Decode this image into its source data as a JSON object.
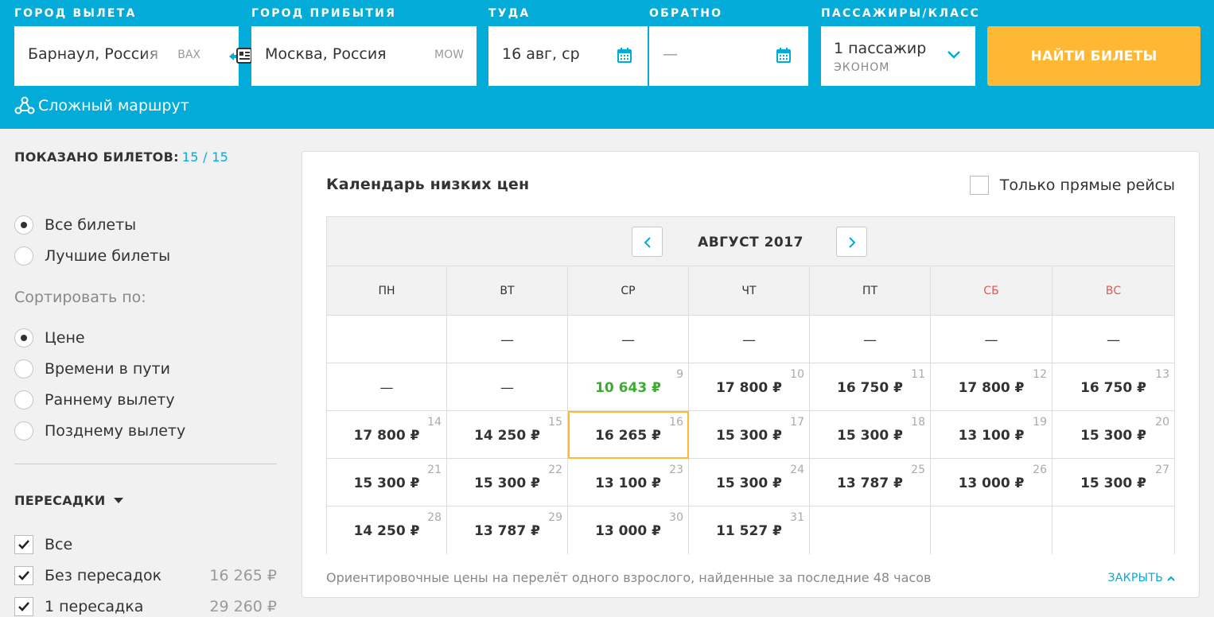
{
  "search": {
    "from_label": "ГОРОД ВЫЛЕТА",
    "from_value": "Барнаул, Россия",
    "from_code": "BAX",
    "to_label": "ГОРОД ПРИБЫТИЯ",
    "to_value": "Москва, Россия",
    "to_code": "MOW",
    "depart_label": "ТУДА",
    "depart_value": "16 авг, ср",
    "return_label": "ОБРАТНО",
    "return_value": "—",
    "pax_label": "ПАССАЖИРЫ/КЛАСС",
    "pax_value": "1 пассажир",
    "pax_class": "ЭКОНОМ",
    "find_button": "НАЙТИ БИЛЕТЫ",
    "complex_route": "Сложный маршрут",
    "icons": [
      "swap-icon",
      "calendar-icon",
      "chevron-down-icon",
      "route-icon"
    ],
    "colors": {
      "header_bg": "#02abd8",
      "button_bg": "#ffb833"
    }
  },
  "sidebar": {
    "shown_label": "ПОКАЗАНО БИЛЕТОВ:",
    "shown_count": "15 / 15",
    "filter_options": [
      {
        "label": "Все билеты",
        "checked": true
      },
      {
        "label": "Лучшие билеты",
        "checked": false
      }
    ],
    "sort_title": "Сортировать по:",
    "sort_options": [
      {
        "label": "Цене",
        "checked": true
      },
      {
        "label": "Времени в пути",
        "checked": false
      },
      {
        "label": "Раннему вылету",
        "checked": false
      },
      {
        "label": "Позднему вылету",
        "checked": false
      }
    ],
    "transfers_title": "ПЕРЕСАДКИ",
    "transfers": [
      {
        "label": "Все",
        "price": "",
        "checked": true
      },
      {
        "label": "Без пересадок",
        "price": "16 265 ₽",
        "checked": true
      },
      {
        "label": "1 пересадка",
        "price": "29 260 ₽",
        "checked": true
      }
    ]
  },
  "calendar": {
    "title": "Календарь низких цен",
    "direct_only": "Только прямые рейсы",
    "month": "АВГУСТ 2017",
    "weekdays": [
      "ПН",
      "ВТ",
      "СР",
      "ЧТ",
      "ПТ",
      "СБ",
      "ВС"
    ],
    "weekend_color": "#e45858",
    "cheap_color": "#3aac2e",
    "selected_color": "#ffb833",
    "weeks": [
      [
        {
          "day": "",
          "price": ""
        },
        {
          "day": "",
          "price": "—"
        },
        {
          "day": "",
          "price": "—"
        },
        {
          "day": "",
          "price": "—"
        },
        {
          "day": "",
          "price": "—"
        },
        {
          "day": "",
          "price": "—"
        },
        {
          "day": "",
          "price": "—"
        }
      ],
      [
        {
          "day": "",
          "price": "—"
        },
        {
          "day": "",
          "price": "—"
        },
        {
          "day": "9",
          "price": "10 643 ₽",
          "cheap": true
        },
        {
          "day": "10",
          "price": "17 800 ₽"
        },
        {
          "day": "11",
          "price": "16 750 ₽"
        },
        {
          "day": "12",
          "price": "17 800 ₽"
        },
        {
          "day": "13",
          "price": "16 750 ₽"
        }
      ],
      [
        {
          "day": "14",
          "price": "17 800 ₽"
        },
        {
          "day": "15",
          "price": "14 250 ₽"
        },
        {
          "day": "16",
          "price": "16 265 ₽",
          "selected": true
        },
        {
          "day": "17",
          "price": "15 300 ₽"
        },
        {
          "day": "18",
          "price": "15 300 ₽"
        },
        {
          "day": "19",
          "price": "13 100 ₽"
        },
        {
          "day": "20",
          "price": "15 300 ₽"
        }
      ],
      [
        {
          "day": "21",
          "price": "15 300 ₽"
        },
        {
          "day": "22",
          "price": "15 300 ₽"
        },
        {
          "day": "23",
          "price": "13 100 ₽"
        },
        {
          "day": "24",
          "price": "15 300 ₽"
        },
        {
          "day": "25",
          "price": "13 787 ₽"
        },
        {
          "day": "26",
          "price": "13 000 ₽"
        },
        {
          "day": "27",
          "price": "15 300 ₽"
        }
      ],
      [
        {
          "day": "28",
          "price": "14 250 ₽"
        },
        {
          "day": "29",
          "price": "13 787 ₽"
        },
        {
          "day": "30",
          "price": "13 000 ₽"
        },
        {
          "day": "31",
          "price": "11 527 ₽"
        },
        {
          "day": "",
          "price": ""
        },
        {
          "day": "",
          "price": ""
        },
        {
          "day": "",
          "price": ""
        }
      ]
    ],
    "note": "Ориентировочные цены на перелёт одного взрослого, найденные за последние 48 часов",
    "close": "ЗАКРЫТЬ"
  }
}
